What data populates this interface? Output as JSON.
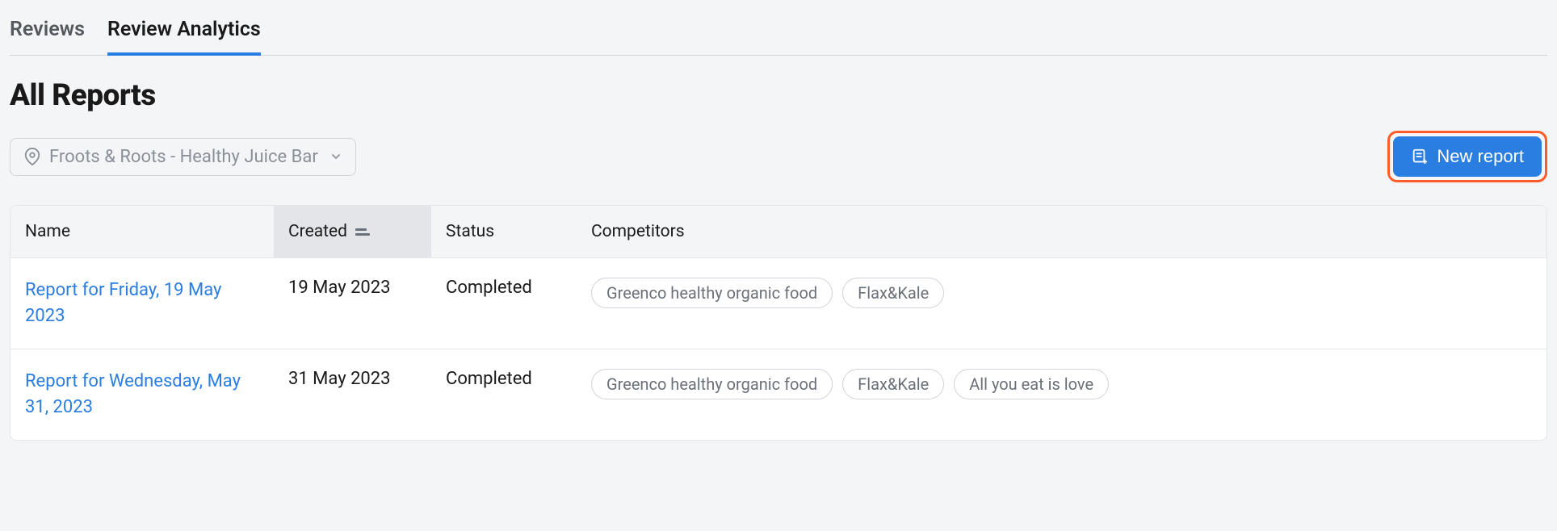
{
  "tabs": {
    "reviews": "Reviews",
    "analytics": "Review Analytics"
  },
  "page_title": "All Reports",
  "location_filter": {
    "selected": "Froots & Roots - Healthy Juice Bar"
  },
  "new_report_button": "New report",
  "table": {
    "headers": {
      "name": "Name",
      "created": "Created",
      "status": "Status",
      "competitors": "Competitors"
    },
    "rows": [
      {
        "name": "Report for Friday, 19 May 2023",
        "created": "19 May 2023",
        "status": "Completed",
        "competitors": [
          "Greenco healthy organic food",
          "Flax&Kale"
        ]
      },
      {
        "name": "Report for Wednesday, May 31, 2023",
        "created": "31 May 2023",
        "status": "Completed",
        "competitors": [
          "Greenco healthy organic food",
          "Flax&Kale",
          "All you eat is love"
        ]
      }
    ]
  }
}
